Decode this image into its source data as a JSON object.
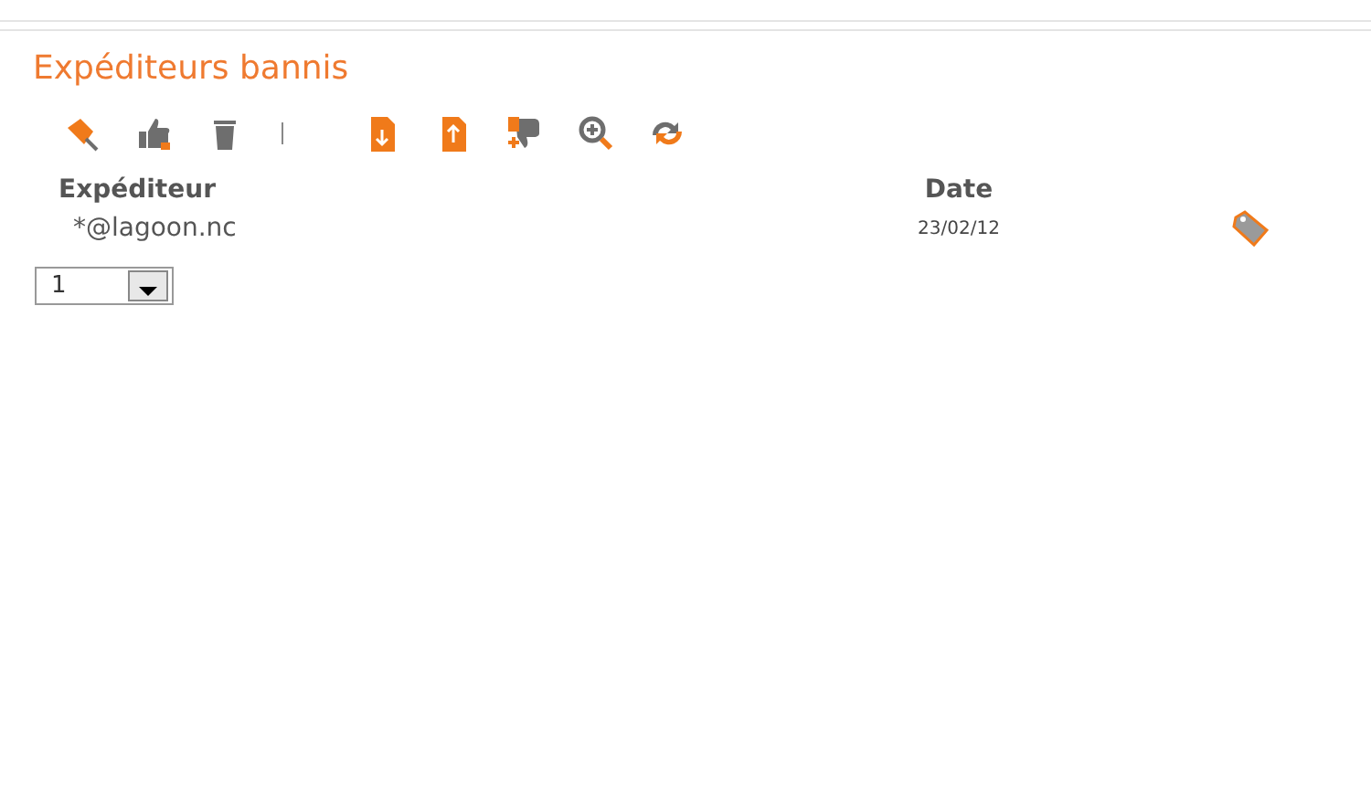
{
  "title": "Expéditeurs bannis",
  "toolbar": [
    {
      "kind": "pin"
    },
    {
      "kind": "thumbup"
    },
    {
      "kind": "trash"
    },
    {
      "kind": "separator"
    },
    {
      "kind": "import"
    },
    {
      "kind": "export"
    },
    {
      "kind": "thumbdown"
    },
    {
      "kind": "zoom"
    },
    {
      "kind": "refresh"
    }
  ],
  "table": {
    "columns": [
      "Expéditeur",
      "Date"
    ],
    "rows": [
      {
        "sender": "*@lagoon.nc",
        "date": "23/02/12"
      }
    ]
  },
  "pager": {
    "value": "1"
  }
}
